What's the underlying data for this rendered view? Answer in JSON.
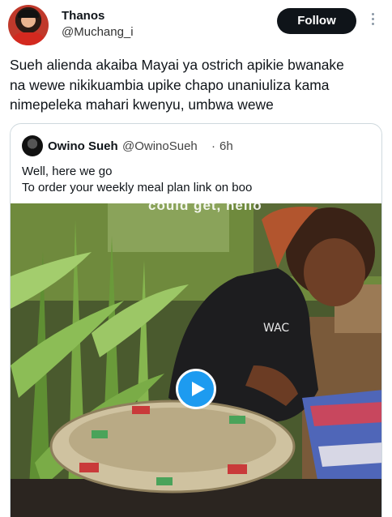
{
  "author": {
    "name": "Thanos",
    "handle": "@Muchang_i"
  },
  "follow_label": "Follow",
  "tweet": {
    "lines": [
      "Sueh alienda akaiba Mayai ya ostrich apikie bwanake",
      "na wewe nikikuambia upike chapo unaniuliza kama",
      "nimepeleka mahari kwenyu, umbwa wewe"
    ]
  },
  "quoted": {
    "name": "Owino Sueh",
    "handle": "@OwinoSueh",
    "separator": "·",
    "time": "6h",
    "lines": [
      "Well, here we go",
      "To order your weekly meal plan link on boo"
    ],
    "video": {
      "caption": "could get, hello"
    }
  },
  "colors": {
    "follow_bg": "#0f1419",
    "play_button": "#1d9bf0",
    "border": "#cfd9de"
  }
}
